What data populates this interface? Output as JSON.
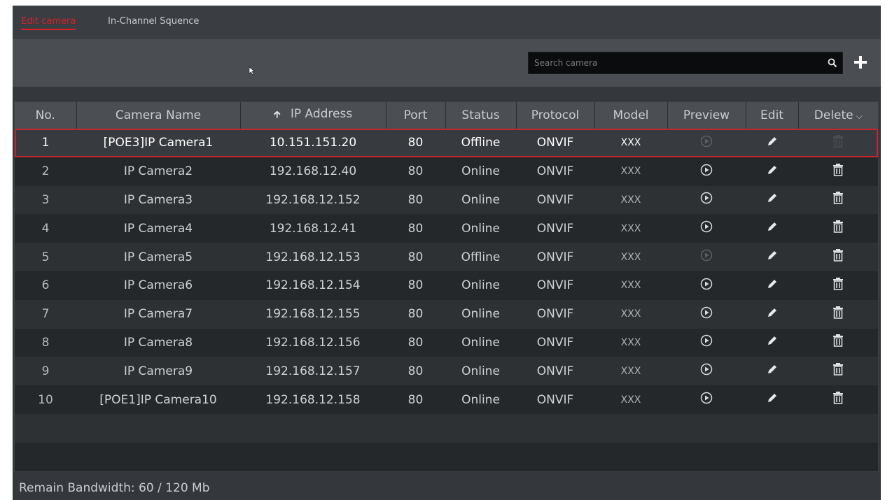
{
  "tabs": [
    {
      "label": "Edit camera",
      "active": true
    },
    {
      "label": "In-Channel Squence",
      "active": false
    }
  ],
  "search": {
    "placeholder": "Search camera"
  },
  "icons": {
    "search": "search-icon",
    "add": "plus-icon",
    "sort": "arrow-up-icon",
    "menu": "chevron-down-icon",
    "preview": "play-icon",
    "edit": "pencil-icon",
    "delete": "trash-icon"
  },
  "colors": {
    "accent": "#d6232a",
    "header_bg": "#4b4e52",
    "panel_bg": "#34373b"
  },
  "table": {
    "columns": [
      "No.",
      "Camera Name",
      "IP Address",
      "Port",
      "Status",
      "Protocol",
      "Model",
      "Preview",
      "Edit",
      "Delete"
    ],
    "rows": [
      {
        "no": "1",
        "name": "[POE3]IP Camera1",
        "ip": "10.151.151.20",
        "port": "80",
        "status": "Offline",
        "protocol": "ONVIF",
        "model": "XXX",
        "selected": true
      },
      {
        "no": "2",
        "name": "IP Camera2",
        "ip": "192.168.12.40",
        "port": "80",
        "status": "Online",
        "protocol": "ONVIF",
        "model": "XXX"
      },
      {
        "no": "3",
        "name": "IP Camera3",
        "ip": "192.168.12.152",
        "port": "80",
        "status": "Online",
        "protocol": "ONVIF",
        "model": "XXX"
      },
      {
        "no": "4",
        "name": "IP Camera4",
        "ip": "192.168.12.41",
        "port": "80",
        "status": "Online",
        "protocol": "ONVIF",
        "model": "XXX"
      },
      {
        "no": "5",
        "name": "IP Camera5",
        "ip": "192.168.12.153",
        "port": "80",
        "status": "Offline",
        "protocol": "ONVIF",
        "model": "XXX"
      },
      {
        "no": "6",
        "name": "IP Camera6",
        "ip": "192.168.12.154",
        "port": "80",
        "status": "Online",
        "protocol": "ONVIF",
        "model": "XXX"
      },
      {
        "no": "7",
        "name": "IP Camera7",
        "ip": "192.168.12.155",
        "port": "80",
        "status": "Online",
        "protocol": "ONVIF",
        "model": "XXX"
      },
      {
        "no": "8",
        "name": "IP Camera8",
        "ip": "192.168.12.156",
        "port": "80",
        "status": "Online",
        "protocol": "ONVIF",
        "model": "XXX"
      },
      {
        "no": "9",
        "name": "IP Camera9",
        "ip": "192.168.12.157",
        "port": "80",
        "status": "Online",
        "protocol": "ONVIF",
        "model": "XXX"
      },
      {
        "no": "10",
        "name": "[POE1]IP Camera10",
        "ip": "192.168.12.158",
        "port": "80",
        "status": "Online",
        "protocol": "ONVIF",
        "model": "XXX"
      }
    ]
  },
  "footer": {
    "bandwidth": "Remain Bandwidth: 60 / 120 Mb"
  }
}
